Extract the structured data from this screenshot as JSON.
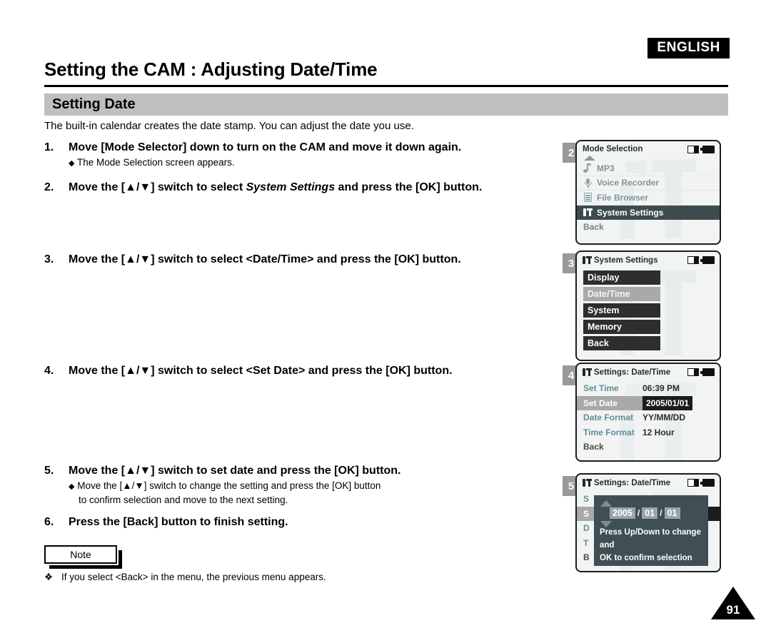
{
  "language_badge": "ENGLISH",
  "page_title": "Setting the CAM : Adjusting Date/Time",
  "section_heading": "Setting Date",
  "intro": "The built-in calendar creates the date stamp. You can adjust the date you use.",
  "page_number": "91",
  "steps": [
    {
      "num": "1.",
      "text": "Move [Mode Selector] down to turn on the CAM and move it down again.",
      "sub": "The Mode Selection screen appears.",
      "sub2": ""
    },
    {
      "num": "2.",
      "text_a": "Move the [▲/▼] switch to select ",
      "text_italic": "System Settings",
      "text_b": " and press the [OK] button.",
      "sub": "",
      "sub2": ""
    },
    {
      "num": "3.",
      "text": "Move the [▲/▼] switch to select <Date/Time> and press the [OK] button.",
      "sub": "",
      "sub2": ""
    },
    {
      "num": "4.",
      "text": "Move the [▲/▼] switch to select <Set Date> and press the [OK] button.",
      "sub": "",
      "sub2": ""
    },
    {
      "num": "5.",
      "text": "Move the [▲/▼] switch to set date and press the [OK] button.",
      "sub": "Move the [▲/▼] switch to change the setting and press the [OK] button",
      "sub2": "to confirm selection and move to the next setting."
    },
    {
      "num": "6.",
      "text": "Press the [Back] button to finish setting.",
      "sub": "",
      "sub2": ""
    }
  ],
  "note": {
    "label": "Note",
    "bullet": "❖",
    "item": "If you select <Back> in the menu, the previous menu appears."
  },
  "screens": [
    {
      "badge": "2",
      "title": "Mode Selection",
      "has_tools_icon": false,
      "has_scroll_arrow": true,
      "icons": [
        "memory-card-icon",
        "battery-icon"
      ],
      "items": [
        {
          "label": "MP3",
          "icon": "music-note-icon",
          "state": "normal"
        },
        {
          "label": "Voice Recorder",
          "icon": "microphone-icon",
          "state": "normal"
        },
        {
          "label": "File Browser",
          "icon": "document-icon",
          "state": "normal"
        },
        {
          "label": "System Settings",
          "icon": "tools-icon",
          "state": "selected"
        },
        {
          "label": "Back",
          "icon": "none",
          "state": "plain"
        }
      ]
    },
    {
      "badge": "3",
      "title": "System Settings",
      "has_tools_icon": true,
      "has_scroll_arrow": false,
      "icons": [
        "memory-card-icon",
        "battery-icon"
      ],
      "buttons": [
        {
          "label": "Display",
          "state": "normal"
        },
        {
          "label": "Date/Time",
          "state": "highlight"
        },
        {
          "label": "System",
          "state": "normal"
        },
        {
          "label": "Memory",
          "state": "normal"
        },
        {
          "label": "Back",
          "state": "normal"
        }
      ]
    },
    {
      "badge": "4",
      "title": "Settings: Date/Time",
      "has_tools_icon": true,
      "has_scroll_arrow": false,
      "icons": [
        "memory-card-icon",
        "battery-icon"
      ],
      "rows": [
        {
          "label": "Set Time",
          "value": "06:39 PM",
          "state": "normal"
        },
        {
          "label": "Set Date",
          "value": "2005/01/01",
          "state": "selected"
        },
        {
          "label": "Date Format",
          "value": "YY/MM/DD",
          "state": "normal"
        },
        {
          "label": "Time Format",
          "value": "12 Hour",
          "state": "normal"
        },
        {
          "label": "Back",
          "value": "",
          "state": "back"
        }
      ]
    },
    {
      "badge": "5",
      "title": "Settings: Date/Time",
      "has_tools_icon": true,
      "has_scroll_arrow": false,
      "icons": [
        "memory-card-icon",
        "battery-icon"
      ],
      "rows": [
        {
          "label": "S",
          "value": "",
          "state": "normal"
        },
        {
          "label": "S",
          "value": "",
          "state": "selected"
        },
        {
          "label": "D",
          "value": "",
          "state": "normal"
        },
        {
          "label": "T",
          "value": "",
          "state": "normal"
        },
        {
          "label": "B",
          "value": "",
          "state": "back"
        }
      ],
      "dialog": {
        "year": "2005",
        "sep1": "/",
        "month": "01",
        "sep2": "/",
        "day": "01",
        "hint_line1": "Press Up/Down to change and",
        "hint_line2": "OK to confirm selection"
      }
    }
  ],
  "colors": {
    "band": "#bfbfbf",
    "badge_bg": "#9a9a9a",
    "lcd_bg": "#f2f4f4",
    "selected_row": "#3d4b4e",
    "label_teal": "#5e8f96",
    "dialog_bg": "#3f4f53"
  }
}
